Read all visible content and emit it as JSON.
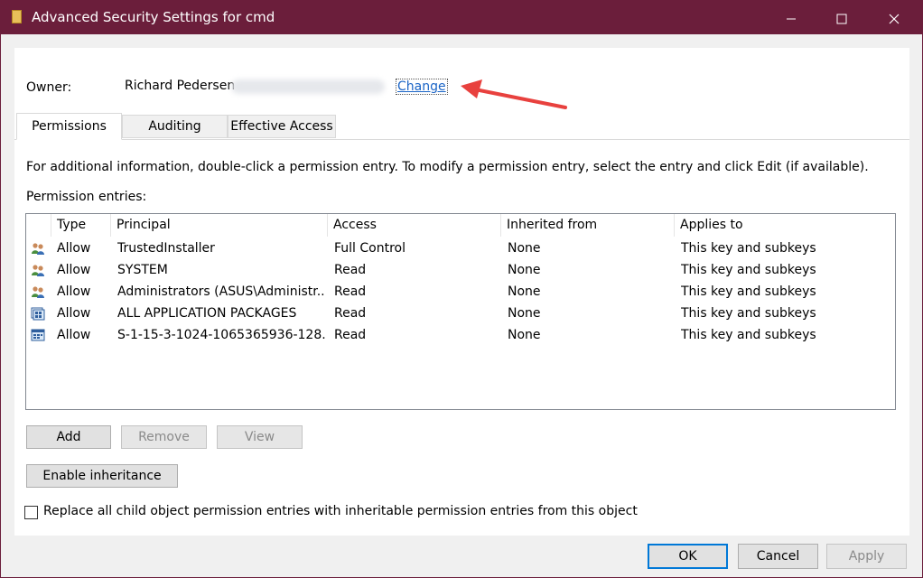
{
  "window": {
    "title": "Advanced Security Settings for cmd",
    "controls": [
      "minimize-icon",
      "maximize-icon",
      "close-icon"
    ],
    "colors": {
      "titlebar": "#6b1e3b",
      "link": "#1a64c6",
      "annotation_arrow": "#e8413e"
    }
  },
  "owner": {
    "label": "Owner:",
    "name": "Richard Pedersen",
    "change_link": "Change"
  },
  "tabs": [
    {
      "label": "Permissions",
      "active": true
    },
    {
      "label": "Auditing",
      "active": false
    },
    {
      "label": "Effective Access",
      "active": false
    }
  ],
  "info_text": "For additional information, double-click a permission entry. To modify a permission entry, select the entry and click Edit (if available).",
  "entries_label": "Permission entries:",
  "table": {
    "columns": [
      "Type",
      "Principal",
      "Access",
      "Inherited from",
      "Applies to"
    ],
    "rows": [
      {
        "icon": "users-group-icon",
        "type": "Allow",
        "principal": "TrustedInstaller",
        "access": "Full Control",
        "inherited": "None",
        "applies": "This key and subkeys"
      },
      {
        "icon": "users-group-icon",
        "type": "Allow",
        "principal": "SYSTEM",
        "access": "Read",
        "inherited": "None",
        "applies": "This key and subkeys"
      },
      {
        "icon": "users-group-icon",
        "type": "Allow",
        "principal": "Administrators (ASUS\\Administr...",
        "access": "Read",
        "inherited": "None",
        "applies": "This key and subkeys"
      },
      {
        "icon": "app-packages-icon",
        "type": "Allow",
        "principal": "ALL APPLICATION PACKAGES",
        "access": "Read",
        "inherited": "None",
        "applies": "This key and subkeys"
      },
      {
        "icon": "app-package-sid-icon",
        "type": "Allow",
        "principal": "S-1-15-3-1024-1065365936-128...",
        "access": "Read",
        "inherited": "None",
        "applies": "This key and subkeys"
      }
    ]
  },
  "buttons": {
    "add": "Add",
    "remove": "Remove",
    "view": "View",
    "enable_inheritance": "Enable inheritance"
  },
  "replace_checkbox": {
    "checked": false,
    "label": "Replace all child object permission entries with inheritable permission entries from this object"
  },
  "footer": {
    "ok": "OK",
    "cancel": "Cancel",
    "apply": "Apply"
  }
}
